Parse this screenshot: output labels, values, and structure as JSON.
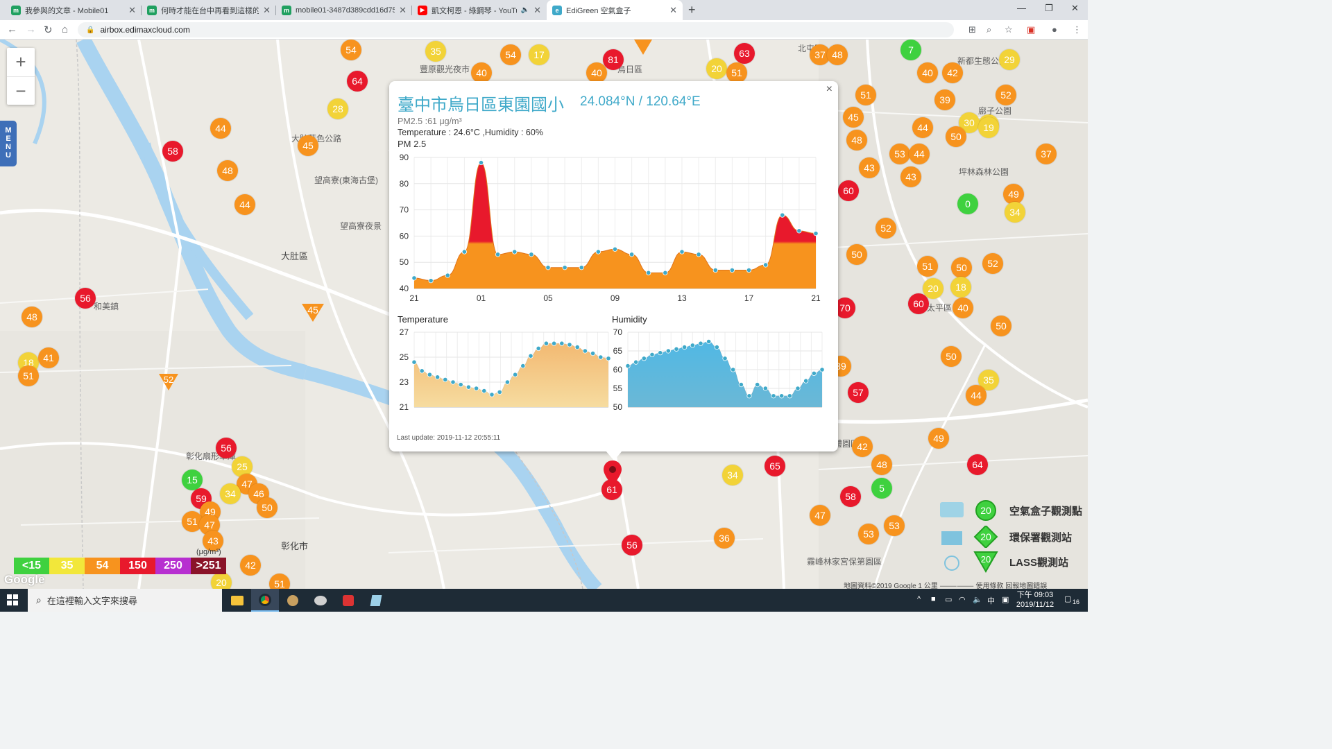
{
  "browser": {
    "tabs": [
      {
        "title": "我參與的文章 - Mobile01",
        "color": "#20a060",
        "glyph": "m"
      },
      {
        "title": "何時才能在台中再看到這樣的藍天",
        "color": "#20a060",
        "glyph": "m"
      },
      {
        "title": "mobile01-3487d389cdd16d75f",
        "color": "#20a060",
        "glyph": "m"
      },
      {
        "title": "凱文柯恩 - 綠鋼琴 - YouTube",
        "color": "#ff0000",
        "glyph": "▶"
      },
      {
        "title": "EdiGreen 空氣盒子",
        "color": "#3fa9c9",
        "glyph": "e"
      }
    ],
    "new_tab": "+",
    "url": "airbox.edimaxcloud.com"
  },
  "map": {
    "zoom_in": "+",
    "zoom_out": "−",
    "menu_label": [
      "M",
      "E",
      "N",
      "U"
    ],
    "labels": [
      {
        "text": "大肚區",
        "cls": "big"
      },
      {
        "text": "彰化市",
        "cls": "big"
      },
      {
        "text": "和美鎮",
        "cls": ""
      },
      {
        "text": "大肚藍色公路",
        "cls": ""
      },
      {
        "text": "望高寮(東海古堡)",
        "cls": ""
      },
      {
        "text": "望高寮夜景",
        "cls": ""
      },
      {
        "text": "新都生態公園",
        "cls": ""
      },
      {
        "text": "廍子公園",
        "cls": ""
      },
      {
        "text": "坪林森林公園",
        "cls": ""
      },
      {
        "text": "霧峰林家宮保第園區",
        "cls": ""
      },
      {
        "text": "經濟部台中軟體園區",
        "cls": ""
      },
      {
        "text": "彰化扇形車庫",
        "cls": ""
      },
      {
        "text": "豐原觀光夜市",
        "cls": ""
      },
      {
        "text": "北屯區",
        "cls": ""
      },
      {
        "text": "太平區",
        "cls": ""
      },
      {
        "text": "烏日區",
        "cls": ""
      }
    ],
    "markers": [
      {
        "v": "54",
        "c": "o"
      },
      {
        "v": "35",
        "c": "y"
      },
      {
        "v": "54",
        "c": "o"
      },
      {
        "v": "17",
        "c": "y"
      },
      {
        "v": "40",
        "c": "o"
      },
      {
        "v": "64",
        "c": "r"
      },
      {
        "v": "28",
        "c": "y"
      },
      {
        "v": "81",
        "c": "r"
      },
      {
        "v": "40",
        "c": "o"
      },
      {
        "v": "63",
        "c": "r"
      },
      {
        "v": "20",
        "c": "y"
      },
      {
        "v": "51",
        "c": "o"
      },
      {
        "v": "37",
        "c": "o"
      },
      {
        "v": "48",
        "c": "o"
      },
      {
        "v": "7",
        "c": "g"
      },
      {
        "v": "29",
        "c": "y"
      },
      {
        "v": "40",
        "c": "o"
      },
      {
        "v": "42",
        "c": "o"
      },
      {
        "v": "52",
        "c": "o"
      },
      {
        "v": "39",
        "c": "o"
      },
      {
        "v": "19",
        "c": "y"
      },
      {
        "v": "51",
        "c": "o"
      },
      {
        "v": "45",
        "c": "o"
      },
      {
        "v": "44",
        "c": "o"
      },
      {
        "v": "30",
        "c": "y"
      },
      {
        "v": "19",
        "c": "y"
      },
      {
        "v": "50",
        "c": "o"
      },
      {
        "v": "48",
        "c": "o"
      },
      {
        "v": "53",
        "c": "o"
      },
      {
        "v": "44",
        "c": "o"
      },
      {
        "v": "37",
        "c": "o"
      },
      {
        "v": "43",
        "c": "o"
      },
      {
        "v": "43",
        "c": "o"
      },
      {
        "v": "60",
        "c": "r"
      },
      {
        "v": "49",
        "c": "o"
      },
      {
        "v": "0",
        "c": "g"
      },
      {
        "v": "34",
        "c": "y"
      },
      {
        "v": "52",
        "c": "o"
      },
      {
        "v": "50",
        "c": "o"
      },
      {
        "v": "51",
        "c": "o"
      },
      {
        "v": "50",
        "c": "o"
      },
      {
        "v": "52",
        "c": "o"
      },
      {
        "v": "20",
        "c": "y"
      },
      {
        "v": "18",
        "c": "y"
      },
      {
        "v": "60",
        "c": "r"
      },
      {
        "v": "40",
        "c": "o"
      },
      {
        "v": "70",
        "c": "r"
      },
      {
        "v": "50",
        "c": "o"
      },
      {
        "v": "50",
        "c": "o"
      },
      {
        "v": "39",
        "c": "o"
      },
      {
        "v": "35",
        "c": "y"
      },
      {
        "v": "57",
        "c": "r"
      },
      {
        "v": "44",
        "c": "o"
      },
      {
        "v": "49",
        "c": "o"
      },
      {
        "v": "42",
        "c": "o"
      },
      {
        "v": "48",
        "c": "o"
      },
      {
        "v": "64",
        "c": "r"
      },
      {
        "v": "5",
        "c": "g"
      },
      {
        "v": "65",
        "c": "r"
      },
      {
        "v": "34",
        "c": "y"
      },
      {
        "v": "58",
        "c": "r"
      },
      {
        "v": "47",
        "c": "o"
      },
      {
        "v": "53",
        "c": "o"
      },
      {
        "v": "53",
        "c": "o"
      },
      {
        "v": "36",
        "c": "o"
      },
      {
        "v": "56",
        "c": "r"
      },
      {
        "v": "61",
        "c": "r"
      },
      {
        "v": "44",
        "c": "o"
      },
      {
        "v": "58",
        "c": "r"
      },
      {
        "v": "45",
        "c": "o"
      },
      {
        "v": "48",
        "c": "o"
      },
      {
        "v": "44",
        "c": "o"
      },
      {
        "v": "45",
        "c": "o"
      },
      {
        "v": "56",
        "c": "r"
      },
      {
        "v": "48",
        "c": "o"
      },
      {
        "v": "18",
        "c": "y"
      },
      {
        "v": "41",
        "c": "o"
      },
      {
        "v": "51",
        "c": "o"
      },
      {
        "v": "56",
        "c": "r"
      },
      {
        "v": "25",
        "c": "y"
      },
      {
        "v": "15",
        "c": "g"
      },
      {
        "v": "47",
        "c": "o"
      },
      {
        "v": "59",
        "c": "r"
      },
      {
        "v": "34",
        "c": "y"
      },
      {
        "v": "46",
        "c": "o"
      },
      {
        "v": "49",
        "c": "o"
      },
      {
        "v": "50",
        "c": "o"
      },
      {
        "v": "51",
        "c": "o"
      },
      {
        "v": "47",
        "c": "o"
      },
      {
        "v": "43",
        "c": "o"
      },
      {
        "v": "42",
        "c": "o"
      },
      {
        "v": "52",
        "c": "o"
      },
      {
        "v": "20",
        "c": "y"
      },
      {
        "v": "51",
        "c": "o"
      }
    ],
    "scale_unit": "(μg/m³)",
    "scale": [
      {
        "label": "<15",
        "color": "#3fd13f"
      },
      {
        "label": "35",
        "color": "#f2e73a"
      },
      {
        "label": "54",
        "color": "#f7931e"
      },
      {
        "label": "150",
        "color": "#e8192c"
      },
      {
        "label": "250",
        "color": "#b72fd0"
      },
      {
        "label": ">251",
        "color": "#8a1328"
      }
    ],
    "legend": [
      {
        "value": "20",
        "label": "空氣盒子觀測點",
        "icon": "circle-icon"
      },
      {
        "value": "20",
        "label": "環保署觀測站",
        "icon": "diamond-icon"
      },
      {
        "value": "20",
        "label": "LASS觀測站",
        "icon": "triangle-icon"
      }
    ],
    "attribution": "地圖資料©2019 Google   1 公里 ⸻⸻   使用條款   回報地圖錯誤",
    "google": "Google"
  },
  "infowindow": {
    "title": "臺中市烏日區東園國小",
    "coord": "24.084°N / 120.64°E",
    "pm_line": "PM2.5 :61 μg/m³",
    "env_line": "Temperature : 24.6°C ,Humidity : 60%",
    "pm_heading": "PM 2.5",
    "temp_heading": "Temperature",
    "hum_heading": "Humidity",
    "last_update": "Last update: 2019-11-12 20:55:11",
    "close": "×"
  },
  "chart_data": [
    {
      "type": "area",
      "title": "PM 2.5",
      "x_ticks": [
        "21",
        "01",
        "05",
        "09",
        "13",
        "17",
        "21"
      ],
      "ylim": [
        40,
        90
      ],
      "y_ticks": [
        40,
        50,
        60,
        70,
        80,
        90
      ],
      "values": [
        44,
        43,
        45,
        54,
        88,
        53,
        54,
        53,
        48,
        48,
        48,
        54,
        55,
        53,
        46,
        46,
        54,
        53,
        47,
        47,
        47,
        49,
        68,
        62,
        61
      ],
      "threshold": 58,
      "colors": {
        "below": "#f7931e",
        "above": "#e8192c",
        "points": "#3fa9c9"
      }
    },
    {
      "type": "area",
      "title": "Temperature",
      "ylim": [
        21,
        27
      ],
      "y_ticks": [
        21,
        23,
        25,
        27
      ],
      "values": [
        24.6,
        23.9,
        23.6,
        23.4,
        23.2,
        23.0,
        22.8,
        22.6,
        22.5,
        22.3,
        22.0,
        22.2,
        23.0,
        23.6,
        24.3,
        25.1,
        25.7,
        26.1,
        26.1,
        26.1,
        26.0,
        25.8,
        25.5,
        25.3,
        25.0,
        24.9
      ],
      "colors": {
        "fill_top": "#f2b36a",
        "fill_bottom": "#f6dca0",
        "points": "#3fa9c9"
      }
    },
    {
      "type": "area",
      "title": "Humidity",
      "ylim": [
        50,
        70
      ],
      "y_ticks": [
        50,
        55,
        60,
        65,
        70
      ],
      "values": [
        61,
        62,
        63,
        64,
        64.5,
        65,
        65.5,
        66,
        66.5,
        67,
        67.5,
        66,
        63,
        60,
        56,
        53,
        56,
        55,
        53,
        53,
        53,
        55,
        57,
        59,
        60
      ],
      "colors": {
        "fill_top": "#4db8e6",
        "fill_bottom": "#6bb8d6",
        "points": "#3fa9c9"
      }
    }
  ],
  "taskbar": {
    "search_placeholder": "在這裡輸入文字來搜尋",
    "clock_time": "下午 09:03",
    "clock_date": "2019/11/12",
    "ime": "中",
    "notif": "16"
  }
}
